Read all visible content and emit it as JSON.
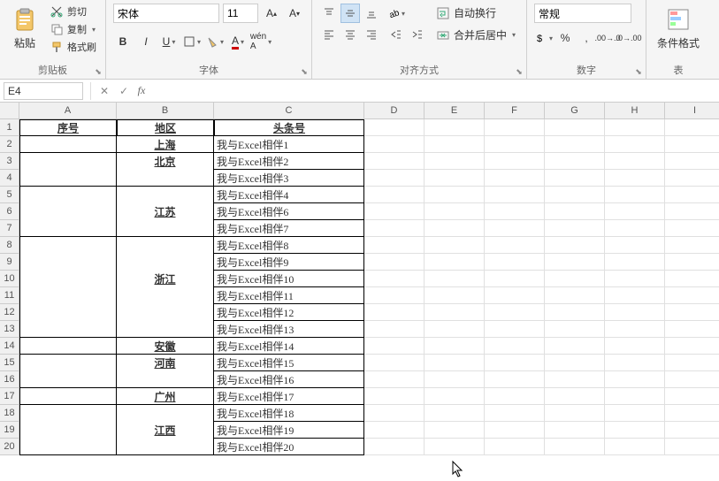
{
  "clipboard": {
    "cut": "剪切",
    "copy": "复制",
    "format_painter": "格式刷",
    "paste": "粘贴",
    "group": "剪贴板"
  },
  "font": {
    "name": "宋体",
    "size": "11",
    "group": "字体"
  },
  "alignment": {
    "wrap": "自动换行",
    "merge": "合并后居中",
    "group": "对齐方式"
  },
  "number": {
    "format": "常规",
    "group": "数字"
  },
  "styles": {
    "cond_format": "条件格式",
    "table": "表"
  },
  "namebox": "E4",
  "columns": [
    "A",
    "B",
    "C",
    "D",
    "E",
    "F",
    "G",
    "H",
    "I"
  ],
  "table": {
    "headers": {
      "a": "序号",
      "b": "地区",
      "c": "头条号"
    },
    "regions": [
      {
        "name": "上海",
        "start": 2,
        "end": 2
      },
      {
        "name": "北京",
        "start": 3,
        "end": 4
      },
      {
        "name": "江苏",
        "start": 5,
        "end": 7
      },
      {
        "name": "浙江",
        "start": 8,
        "end": 13
      },
      {
        "name": "安徽",
        "start": 14,
        "end": 14
      },
      {
        "name": "河南",
        "start": 15,
        "end": 16
      },
      {
        "name": "广州",
        "start": 17,
        "end": 17
      },
      {
        "name": "江西",
        "start": 18,
        "end": 20
      }
    ],
    "items": [
      "我与Excel相伴1",
      "我与Excel相伴2",
      "我与Excel相伴3",
      "我与Excel相伴4",
      "我与Excel相伴6",
      "我与Excel相伴7",
      "我与Excel相伴8",
      "我与Excel相伴9",
      "我与Excel相伴10",
      "我与Excel相伴11",
      "我与Excel相伴12",
      "我与Excel相伴13",
      "我与Excel相伴14",
      "我与Excel相伴15",
      "我与Excel相伴16",
      "我与Excel相伴17",
      "我与Excel相伴18",
      "我与Excel相伴19",
      "我与Excel相伴20"
    ]
  }
}
